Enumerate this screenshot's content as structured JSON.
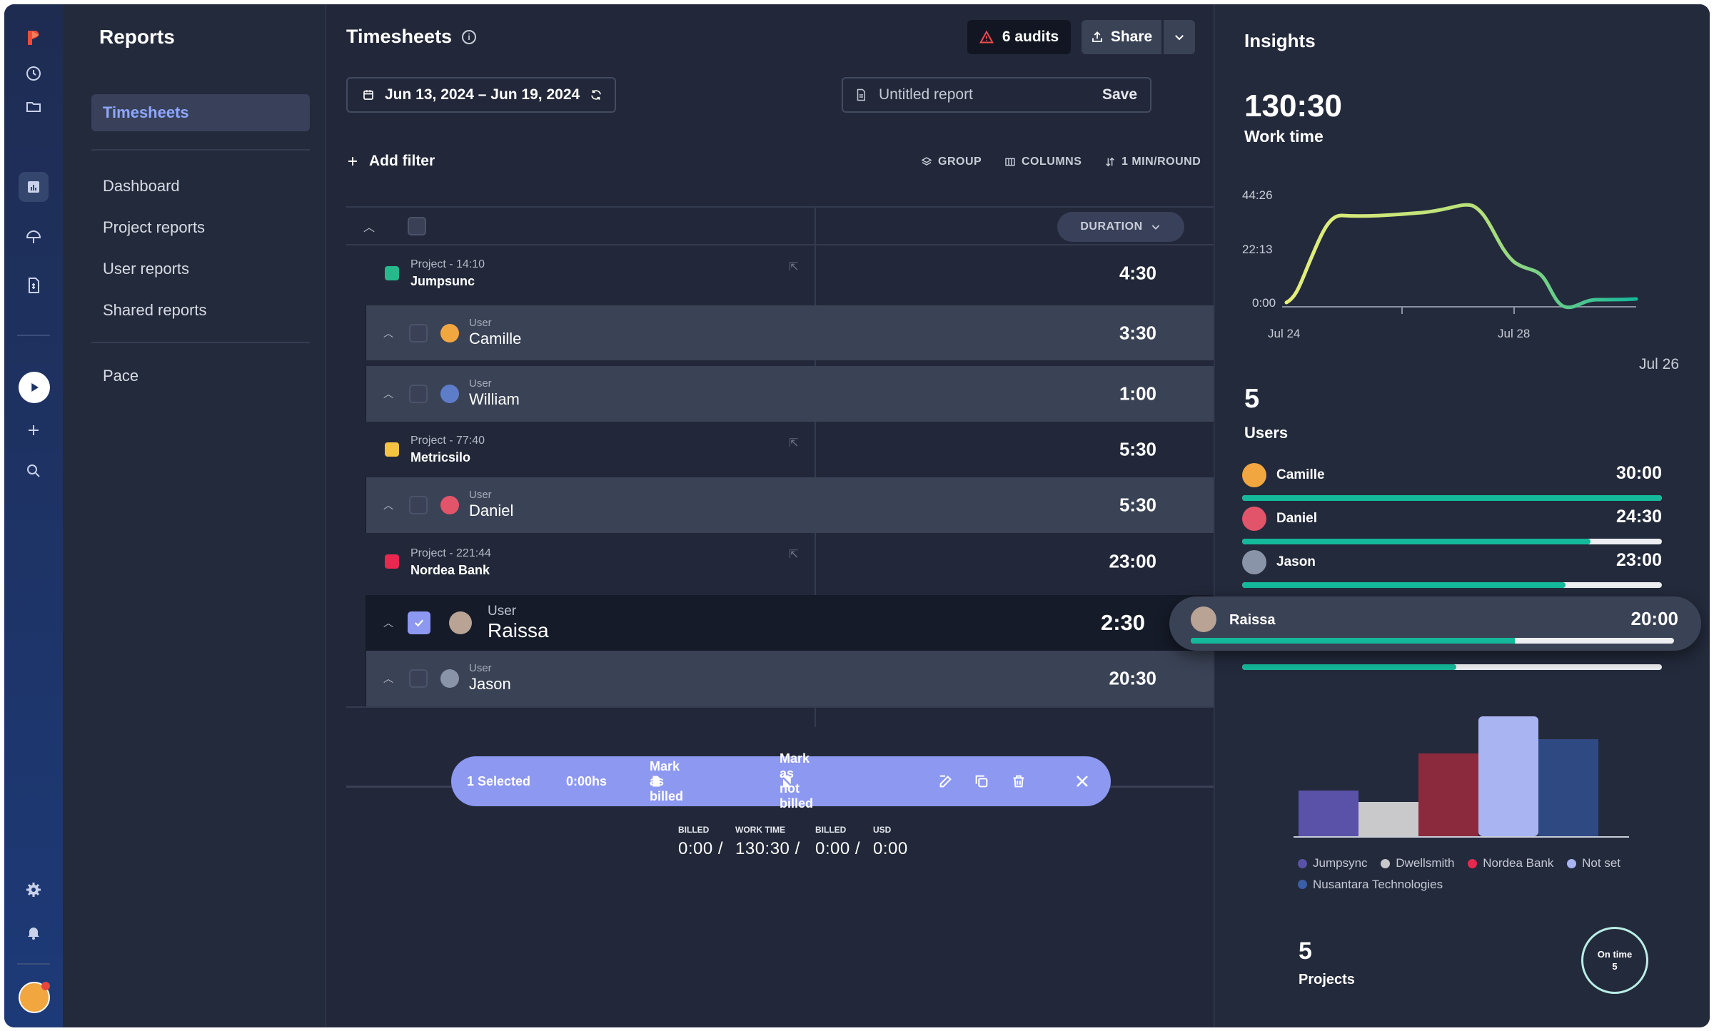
{
  "rail": {
    "icons": [
      "logo-icon",
      "clock-icon",
      "folder-icon",
      "reports-icon",
      "umbrella-icon",
      "invoice-icon",
      "play-icon",
      "plus-icon",
      "search-icon",
      "gear-icon",
      "bell-icon"
    ]
  },
  "sidebar": {
    "title": "Reports",
    "active": "Timesheets",
    "items": [
      "Dashboard",
      "Project reports",
      "User reports",
      "Shared reports"
    ],
    "extra": "Pace"
  },
  "header": {
    "title": "Timesheets",
    "audits": "6 audits",
    "share": "Share",
    "date_range": "Jun 13, 2024 – Jun 19, 2024",
    "report_placeholder": "Untitled report",
    "save": "Save",
    "add_filter": "Add filter",
    "group": "GROUP",
    "columns": "COLUMNS",
    "rounding": "1 MIN/ROUND"
  },
  "table": {
    "duration_header": "DURATION",
    "rows": [
      {
        "kind": "project",
        "sub": "Project - 14:10",
        "name": "Jumpsunc",
        "dur": "4:30",
        "color": "#27b98c"
      },
      {
        "kind": "user",
        "sub": "User",
        "name": "Camille",
        "dur": "3:30"
      },
      {
        "kind": "user",
        "sub": "User",
        "name": "William",
        "dur": "1:00"
      },
      {
        "kind": "project",
        "sub": "Project - 77:40",
        "name": "Metricsilo",
        "dur": "5:30",
        "color": "#f5c342"
      },
      {
        "kind": "user",
        "sub": "User",
        "name": "Daniel",
        "dur": "5:30"
      },
      {
        "kind": "project",
        "sub": "Project - 221:44",
        "name": "Nordea Bank",
        "dur": "23:00",
        "color": "#e8284f"
      },
      {
        "kind": "user",
        "sub": "User",
        "name": "Raissa",
        "dur": "2:30",
        "selected": true
      },
      {
        "kind": "user",
        "sub": "User",
        "name": "Jason",
        "dur": "20:30"
      }
    ]
  },
  "actionbar": {
    "selected": "1 Selected",
    "hours": "0:00hs",
    "mark_billed": "Mark as billed",
    "mark_not_billed": "Mark as not billed"
  },
  "footer": {
    "labels": [
      "BILLED",
      "WORK TIME",
      "BILLED",
      "USD"
    ],
    "values": [
      "0:00 /",
      "130:30 /",
      "0:00 /",
      "0:00"
    ]
  },
  "insights": {
    "title": "Insights",
    "work_time": "130:30",
    "work_time_label": "Work time",
    "chart_data": {
      "type": "line",
      "y_ticks": [
        "44:26",
        "22:13",
        "0:00"
      ],
      "x_ticks": [
        "Jul 24",
        "Jul 28"
      ],
      "extra_label": "Jul 26",
      "color_start": "#e6ef7a",
      "color_end": "#14b89a"
    },
    "users_count": "5",
    "users_label": "Users",
    "users": [
      {
        "name": "Camille",
        "time": "30:00",
        "fraction": 1.0
      },
      {
        "name": "Daniel",
        "time": "24:30",
        "fraction": 0.83
      },
      {
        "name": "Jason",
        "time": "23:00",
        "fraction": 0.77
      },
      {
        "name": "Raissa",
        "time": "20:00",
        "fraction": 0.67
      },
      {
        "name": "",
        "time": "",
        "fraction": 0.51
      }
    ],
    "bar_chart": {
      "type": "bar",
      "series_colors": [
        "#5a52a8",
        "#c9c9cc",
        "#8b2a3c",
        "#a9b4f2",
        "#2f4a83"
      ],
      "legend": [
        {
          "name": "Jumpsync",
          "color": "#5a52a8"
        },
        {
          "name": "Dwellsmith",
          "color": "#c9c9cc"
        },
        {
          "name": "Nordea Bank",
          "color": "#e8284f"
        },
        {
          "name": "Not set",
          "color": "#a9b4f2"
        },
        {
          "name": "Nusantara Technologies",
          "color": "#3b5ea8"
        }
      ]
    },
    "projects_count": "5",
    "projects_label": "Projects",
    "ontime_label": "On time",
    "ontime_value": "5"
  }
}
